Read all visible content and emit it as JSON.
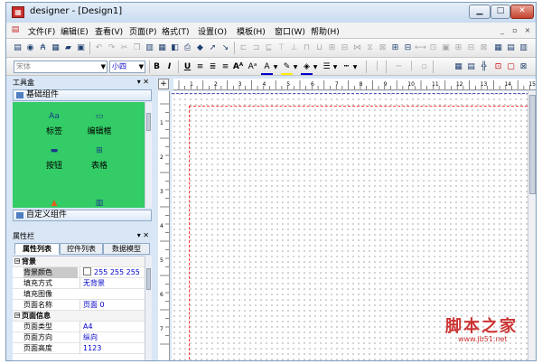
{
  "window": {
    "title": "designer - [Design1]",
    "icon": "report-app-icon",
    "controls": [
      "minimize",
      "maximize",
      "close"
    ]
  },
  "menu": {
    "items": [
      "文件(F)",
      "编辑(E)",
      "查看(V)",
      "页面(P)",
      "格式(T)",
      "设置(O)",
      "模板(H)",
      "窗口(W)",
      "帮助(H)"
    ]
  },
  "toolbar2": {
    "font_name": "宋体",
    "font_size": "小四",
    "bold_label": "B",
    "italic_label": "I",
    "underline_label": "U"
  },
  "toolbox": {
    "title": "工具盒",
    "basic_group": "基础组件",
    "components": [
      {
        "label": "标签",
        "icon": "label-icon"
      },
      {
        "label": "编辑框",
        "icon": "editbox-icon"
      },
      {
        "label": "按钮",
        "icon": "button-icon"
      },
      {
        "label": "表格",
        "icon": "table-icon"
      }
    ],
    "custom_group": "自定义组件",
    "accent": "#33cc66"
  },
  "properties": {
    "title": "属性栏",
    "tabs": [
      "属性列表",
      "控件列表",
      "数据模型"
    ],
    "rows": [
      {
        "type": "cat",
        "label": "背景"
      },
      {
        "type": "prop",
        "label": "背景颜色",
        "value": "255 255 255",
        "swatch": true,
        "selected": true
      },
      {
        "type": "prop",
        "label": "填充方式",
        "value": "无背景"
      },
      {
        "type": "prop",
        "label": "填充图像",
        "value": ""
      },
      {
        "type": "prop",
        "label": "页面名称",
        "value": "页面  0"
      },
      {
        "type": "cat",
        "label": "页面信息"
      },
      {
        "type": "prop",
        "label": "页面类型",
        "value": "A4"
      },
      {
        "type": "prop",
        "label": "页面方向",
        "value": "纵向"
      },
      {
        "type": "prop",
        "label": "页面高度",
        "value": "1123"
      }
    ]
  },
  "ruler": {
    "h_labels": [
      "1",
      "2",
      "3",
      "4",
      "5",
      "6",
      "7",
      "8",
      "9",
      "10",
      "11",
      "12",
      "13",
      "14",
      "15"
    ],
    "v_labels": [
      "1",
      "2",
      "3",
      "4",
      "5",
      "6",
      "7"
    ]
  },
  "watermark": {
    "text": "脚本之家",
    "url": "www.jb51.net"
  }
}
